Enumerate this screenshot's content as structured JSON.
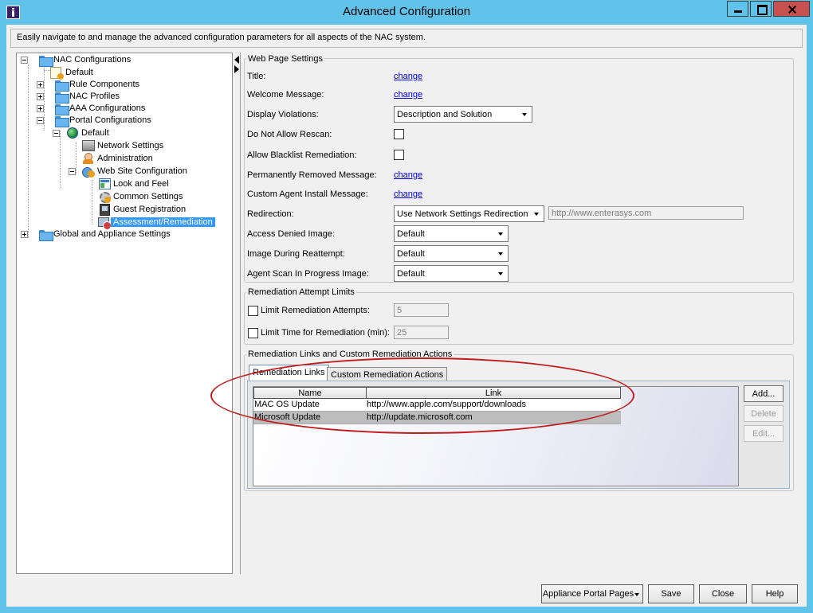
{
  "window": {
    "title": "Advanced Configuration"
  },
  "description": "Easily navigate to and manage the advanced configuration parameters for all aspects of the NAC system.",
  "tree": {
    "nac_configurations": "NAC Configurations",
    "default": "Default",
    "rule_components": "Rule Components",
    "nac_profiles": "NAC Profiles",
    "aaa_configurations": "AAA Configurations",
    "portal_configurations": "Portal Configurations",
    "portal_default": "Default",
    "network_settings": "Network Settings",
    "administration": "Administration",
    "web_site_configuration": "Web Site Configuration",
    "look_and_feel": "Look and Feel",
    "common_settings": "Common Settings",
    "guest_registration": "Guest Registration",
    "assessment_remediation": "Assessment/Remediation",
    "global_appliance": "Global and Appliance Settings"
  },
  "web_page_settings": {
    "legend": "Web Page Settings",
    "title_label": "Title:",
    "welcome_label": "Welcome Message:",
    "display_violations_label": "Display Violations:",
    "display_violations_value": "Description and Solution",
    "no_rescan_label": "Do Not Allow Rescan:",
    "blacklist_label": "Allow Blacklist Remediation:",
    "perm_removed_label": "Permanently Removed Message:",
    "custom_agent_label": "Custom Agent Install Message:",
    "redirection_label": "Redirection:",
    "redirection_value": "Use Network Settings Redirection",
    "redirection_url": "http://www.enterasys.com",
    "access_denied_label": "Access Denied Image:",
    "access_denied_value": "Default",
    "reattempt_label": "Image During Reattempt:",
    "reattempt_value": "Default",
    "agent_scan_label": "Agent Scan In Progress Image:",
    "agent_scan_value": "Default",
    "change_link": "change"
  },
  "remediation_limits": {
    "legend": "Remediation Attempt Limits",
    "limit_attempts_label": "Limit Remediation Attempts:",
    "limit_attempts_value": "5",
    "limit_time_label": "Limit Time for Remediation (min):",
    "limit_time_value": "25"
  },
  "remediation_links": {
    "legend": "Remediation Links and Custom Remediation Actions",
    "tabs": [
      "Remediation Links",
      "Custom Remediation Actions"
    ],
    "columns": [
      "Name",
      "Link"
    ],
    "rows": [
      {
        "name": "MAC OS Update",
        "link": "http://www.apple.com/support/downloads"
      },
      {
        "name": "Microsoft Update",
        "link": "http://update.microsoft.com"
      }
    ],
    "add": "Add...",
    "delete": "Delete",
    "edit": "Edit..."
  },
  "footer": {
    "appliance_portal_pages": "Appliance Portal Pages",
    "save": "Save",
    "close": "Close",
    "help": "Help"
  },
  "colors": {
    "titlebar": "#5fc3ea",
    "selection": "#3399ff",
    "link": "#0000e0",
    "annotation": "#c01e1e"
  }
}
